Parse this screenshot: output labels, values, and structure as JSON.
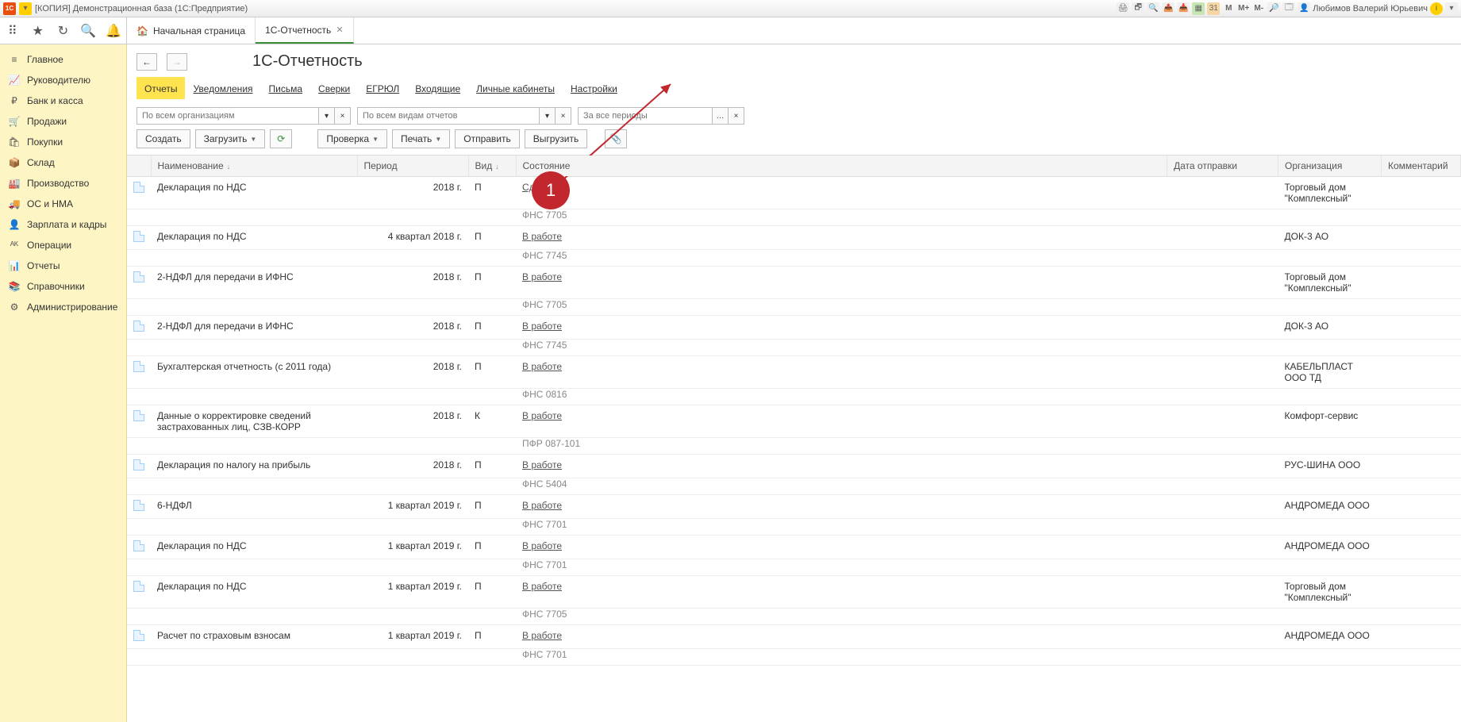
{
  "titlebar": {
    "title": "[КОПИЯ] Демонстрационная база  (1С:Предприятие)",
    "user": "Любимов Валерий Юрьевич",
    "m_buttons": [
      "M",
      "M+",
      "M-"
    ]
  },
  "tabs": {
    "home": "Начальная страница",
    "active": "1С-Отчетность"
  },
  "sidebar": {
    "items": [
      {
        "icon": "≡",
        "label": "Главное"
      },
      {
        "icon": "📈",
        "label": "Руководителю"
      },
      {
        "icon": "₽",
        "label": "Банк и касса"
      },
      {
        "icon": "🛒",
        "label": "Продажи"
      },
      {
        "icon": "🛍",
        "label": "Покупки"
      },
      {
        "icon": "📦",
        "label": "Склад"
      },
      {
        "icon": "🏭",
        "label": "Производство"
      },
      {
        "icon": "🚚",
        "label": "ОС и НМА"
      },
      {
        "icon": "👤",
        "label": "Зарплата и кадры"
      },
      {
        "icon": "ᴬᴷ",
        "label": "Операции"
      },
      {
        "icon": "📊",
        "label": "Отчеты"
      },
      {
        "icon": "📚",
        "label": "Справочники"
      },
      {
        "icon": "⚙",
        "label": "Администрирование"
      }
    ]
  },
  "page": {
    "title": "1С-Отчетность"
  },
  "subtabs": [
    "Отчеты",
    "Уведомления",
    "Письма",
    "Сверки",
    "ЕГРЮЛ",
    "Входящие",
    "Личные кабинеты",
    "Настройки"
  ],
  "filters": {
    "org": "По всем организациям",
    "kind": "По всем видам отчетов",
    "period": "За все периоды"
  },
  "actions": {
    "create": "Создать",
    "load": "Загрузить",
    "check": "Проверка",
    "print": "Печать",
    "send": "Отправить",
    "export": "Выгрузить"
  },
  "columns": {
    "name": "Наименование",
    "period": "Период",
    "kind": "Вид",
    "state": "Состояние",
    "sent": "Дата отправки",
    "org": "Организация",
    "comment": "Комментарий"
  },
  "rows": [
    {
      "name": "Декларация по НДС",
      "period": "2018 г.",
      "kind": "П",
      "state": "Сдано",
      "sub": "ФНС 7705",
      "org": "Торговый дом \"Комплексный\""
    },
    {
      "name": "Декларация по НДС",
      "period": "4 квартал 2018 г.",
      "kind": "П",
      "state": "В работе",
      "sub": "ФНС 7745",
      "org": "ДОК-3 АО"
    },
    {
      "name": "2-НДФЛ для передачи в ИФНС",
      "period": "2018 г.",
      "kind": "П",
      "state": "В работе",
      "sub": "ФНС 7705",
      "org": "Торговый дом \"Комплексный\""
    },
    {
      "name": "2-НДФЛ для передачи в ИФНС",
      "period": "2018 г.",
      "kind": "П",
      "state": "В работе",
      "sub": "ФНС 7745",
      "org": "ДОК-3 АО"
    },
    {
      "name": "Бухгалтерская отчетность (с 2011 года)",
      "period": "2018 г.",
      "kind": "П",
      "state": "В работе",
      "sub": "ФНС 0816",
      "org": "КАБЕЛЬПЛАСТ ООО ТД"
    },
    {
      "name": "Данные о корректировке сведений застрахованных лиц, СЗВ-КОРР",
      "period": "2018 г.",
      "kind": "К",
      "state": "В работе",
      "sub": "ПФР 087-101",
      "org": "Комфорт-сервис"
    },
    {
      "name": "Декларация по налогу на прибыль",
      "period": "2018 г.",
      "kind": "П",
      "state": "В работе",
      "sub": "ФНС 5404",
      "org": "РУС-ШИНА ООО"
    },
    {
      "name": "6-НДФЛ",
      "period": "1 квартал 2019 г.",
      "kind": "П",
      "state": "В работе",
      "sub": "ФНС 7701",
      "org": "АНДРОМЕДА ООО"
    },
    {
      "name": "Декларация по НДС",
      "period": "1 квартал 2019 г.",
      "kind": "П",
      "state": "В работе",
      "sub": "ФНС 7701",
      "org": "АНДРОМЕДА ООО"
    },
    {
      "name": "Декларация по НДС",
      "period": "1 квартал 2019 г.",
      "kind": "П",
      "state": "В работе",
      "sub": "ФНС 7705",
      "org": "Торговый дом \"Комплексный\""
    },
    {
      "name": "Расчет по страховым взносам",
      "period": "1 квартал 2019 г.",
      "kind": "П",
      "state": "В работе",
      "sub": "ФНС 7701",
      "org": "АНДРОМЕДА ООО"
    }
  ],
  "annotation": {
    "num": "1"
  }
}
